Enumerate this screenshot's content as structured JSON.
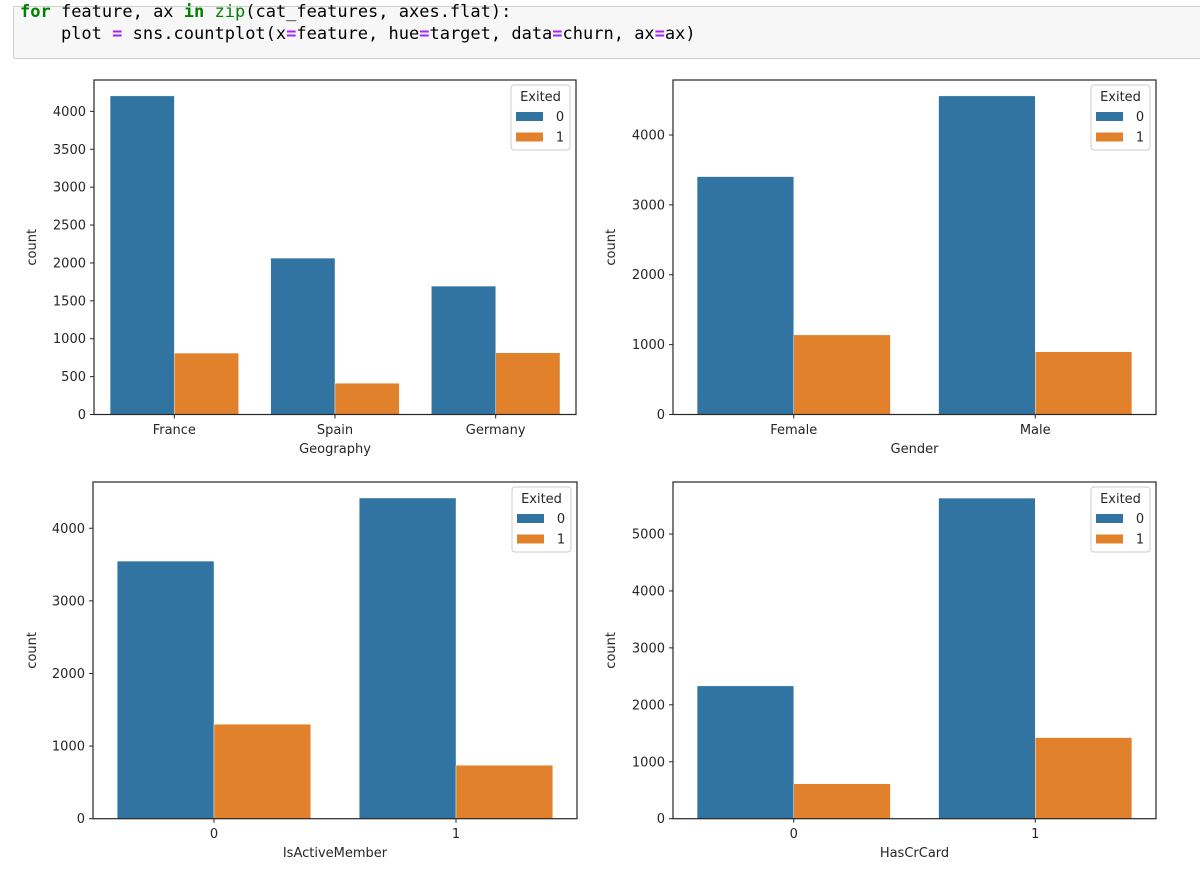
{
  "code_cell": {
    "lines": [
      [
        {
          "t": "for",
          "c": "kw"
        },
        {
          "t": " feature, ax ",
          "c": ""
        },
        {
          "t": "in",
          "c": "kw"
        },
        {
          "t": " ",
          "c": ""
        },
        {
          "t": "zip",
          "c": "bi"
        },
        {
          "t": "(cat_features, axes.flat):",
          "c": ""
        }
      ],
      [
        {
          "t": "    plot ",
          "c": ""
        },
        {
          "t": "=",
          "c": "op"
        },
        {
          "t": " sns.countplot(x",
          "c": ""
        },
        {
          "t": "=",
          "c": "op"
        },
        {
          "t": "feature, hue",
          "c": ""
        },
        {
          "t": "=",
          "c": "op"
        },
        {
          "t": "target, data",
          "c": ""
        },
        {
          "t": "=",
          "c": "op"
        },
        {
          "t": "churn, ax",
          "c": ""
        },
        {
          "t": "=",
          "c": "op"
        },
        {
          "t": "ax)",
          "c": ""
        }
      ]
    ]
  },
  "colors": {
    "exited_0": "#3274a1",
    "exited_1": "#e1812c"
  },
  "chart_data": [
    {
      "type": "bar",
      "title": "",
      "xlabel": "Geography",
      "ylabel": "count",
      "categories": [
        "France",
        "Spain",
        "Germany"
      ],
      "series": [
        {
          "name": "0",
          "values": [
            4204,
            2064,
            1695
          ]
        },
        {
          "name": "1",
          "values": [
            810,
            413,
            814
          ]
        }
      ],
      "yticks": [
        0,
        500,
        1000,
        1500,
        2000,
        2500,
        3000,
        3500,
        4000
      ],
      "ylim": [
        0,
        4414
      ],
      "legend": {
        "title": "Exited",
        "labels": [
          "0",
          "1"
        ],
        "placement": "top-right"
      },
      "grid": false
    },
    {
      "type": "bar",
      "title": "",
      "xlabel": "Gender",
      "ylabel": "count",
      "categories": [
        "Female",
        "Male"
      ],
      "series": [
        {
          "name": "0",
          "values": [
            3404,
            4559
          ]
        },
        {
          "name": "1",
          "values": [
            1139,
            898
          ]
        }
      ],
      "yticks": [
        0,
        1000,
        2000,
        3000,
        4000
      ],
      "ylim": [
        0,
        4787
      ],
      "legend": {
        "title": "Exited",
        "labels": [
          "0",
          "1"
        ],
        "placement": "top-right"
      },
      "grid": false
    },
    {
      "type": "bar",
      "title": "",
      "xlabel": "IsActiveMember",
      "ylabel": "count",
      "categories": [
        "0",
        "1"
      ],
      "series": [
        {
          "name": "0",
          "values": [
            3547,
            4416
          ]
        },
        {
          "name": "1",
          "values": [
            1302,
            735
          ]
        }
      ],
      "yticks": [
        0,
        1000,
        2000,
        3000,
        4000
      ],
      "ylim": [
        0,
        4637
      ],
      "legend": {
        "title": "Exited",
        "labels": [
          "0",
          "1"
        ],
        "placement": "top-right"
      },
      "grid": false
    },
    {
      "type": "bar",
      "title": "",
      "xlabel": "HasCrCard",
      "ylabel": "count",
      "categories": [
        "0",
        "1"
      ],
      "series": [
        {
          "name": "0",
          "values": [
            2332,
            5631
          ]
        },
        {
          "name": "1",
          "values": [
            613,
            1424
          ]
        }
      ],
      "yticks": [
        0,
        1000,
        2000,
        3000,
        4000,
        5000
      ],
      "ylim": [
        0,
        5913
      ],
      "legend": {
        "title": "Exited",
        "labels": [
          "0",
          "1"
        ],
        "placement": "top-right"
      },
      "grid": false
    }
  ]
}
